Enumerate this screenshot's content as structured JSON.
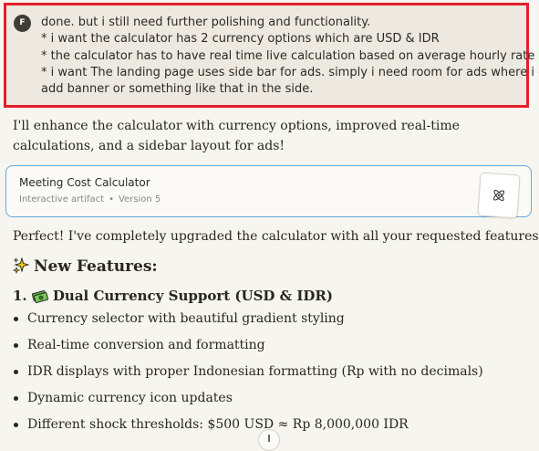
{
  "user_message": {
    "avatar_initial": "F",
    "lines": [
      "done. but i still need further polishing and functionality.",
      "* i want the calculator has 2 currency options which are USD & IDR",
      "* the calculator has to have real time live calculation based on average hourly rate data",
      "* i want The landing page uses side bar for ads. simply i need room for ads where i can",
      "add banner or something like that in the side."
    ]
  },
  "assistant": {
    "intro": "I'll enhance the calculator with currency options, improved real-time calculations, and a sidebar layout for ads!",
    "artifact": {
      "title": "Meeting Cost Calculator",
      "type": "Interactive artifact",
      "separator": "•",
      "version": "Version 5",
      "icon": "atom-icon"
    },
    "perfect": "Perfect! I've completely upgraded the calculator with all your requested features:",
    "features_heading": "New Features:",
    "features_emoji": "sparkles-icon",
    "section_1_number": "1.",
    "section_1_emoji": "money-icon",
    "section_1_title": "Dual Currency Support (USD & IDR)",
    "bullets": [
      "Currency selector with beautiful gradient styling",
      "Real-time conversion and formatting",
      "IDR displays with proper Indonesian formatting (Rp with no decimals)",
      "Dynamic currency icon updates",
      "Different shock thresholds: $500 USD ≈ Rp 8,000,000 IDR"
    ]
  },
  "colors": {
    "highlight_border": "#e3202b",
    "artifact_border": "#64a8e4",
    "background": "#f7f5ef"
  }
}
